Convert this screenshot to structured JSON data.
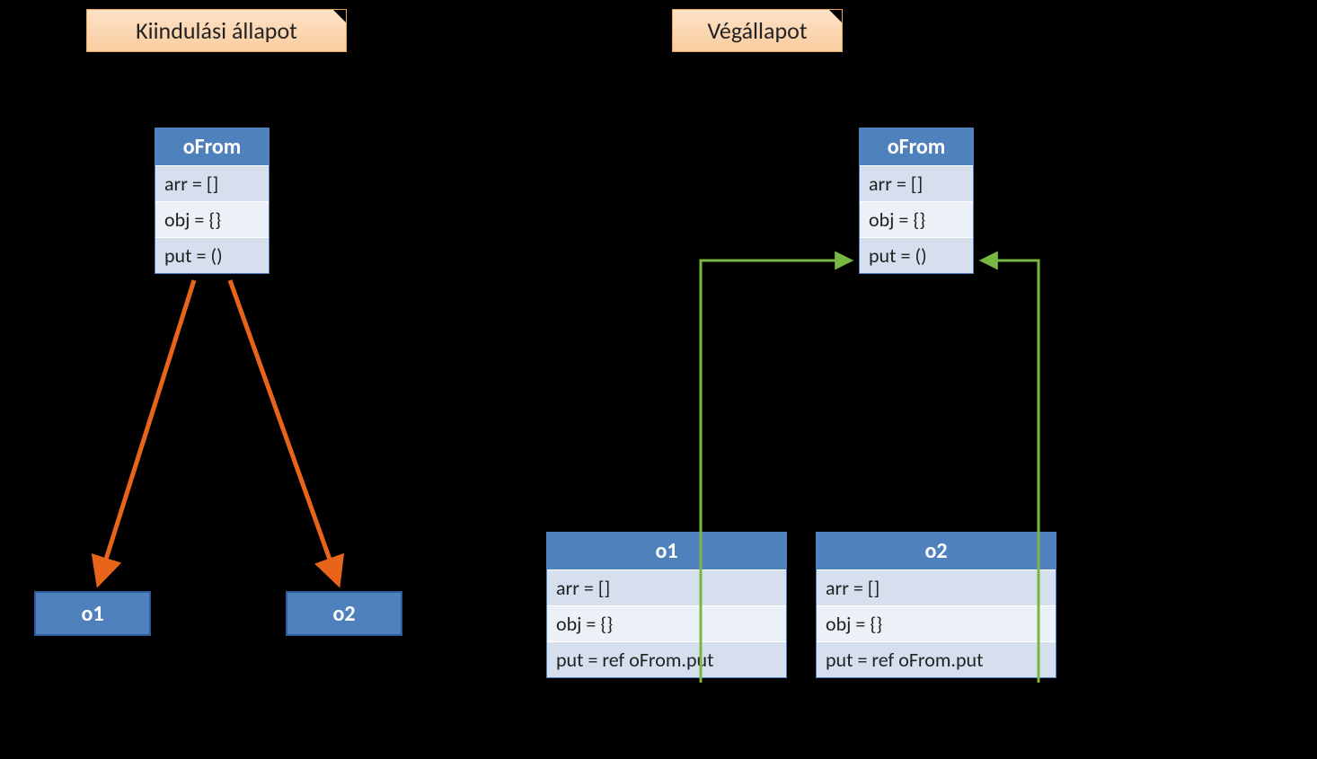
{
  "titles": {
    "left": "Kiindulási állapot",
    "right": "Végállapot"
  },
  "left": {
    "oFrom": {
      "name": "oFrom",
      "props": [
        "arr = []",
        "obj = {}",
        "put = ()"
      ]
    },
    "o1": "o1",
    "o2": "o2"
  },
  "right": {
    "oFrom": {
      "name": "oFrom",
      "props": [
        "arr = []",
        "obj = {}",
        "put = ()"
      ]
    },
    "o1": {
      "name": "o1",
      "props": [
        "arr = []",
        "obj = {}",
        "put = ref oFrom.put"
      ]
    },
    "o2": {
      "name": "o2",
      "props": [
        "arr = []",
        "obj = {}",
        "put = ref oFrom.put"
      ]
    }
  },
  "colors": {
    "orange_arrow": "#E8641B",
    "green_arrow": "#77B843",
    "header_blue": "#4F81BD"
  }
}
